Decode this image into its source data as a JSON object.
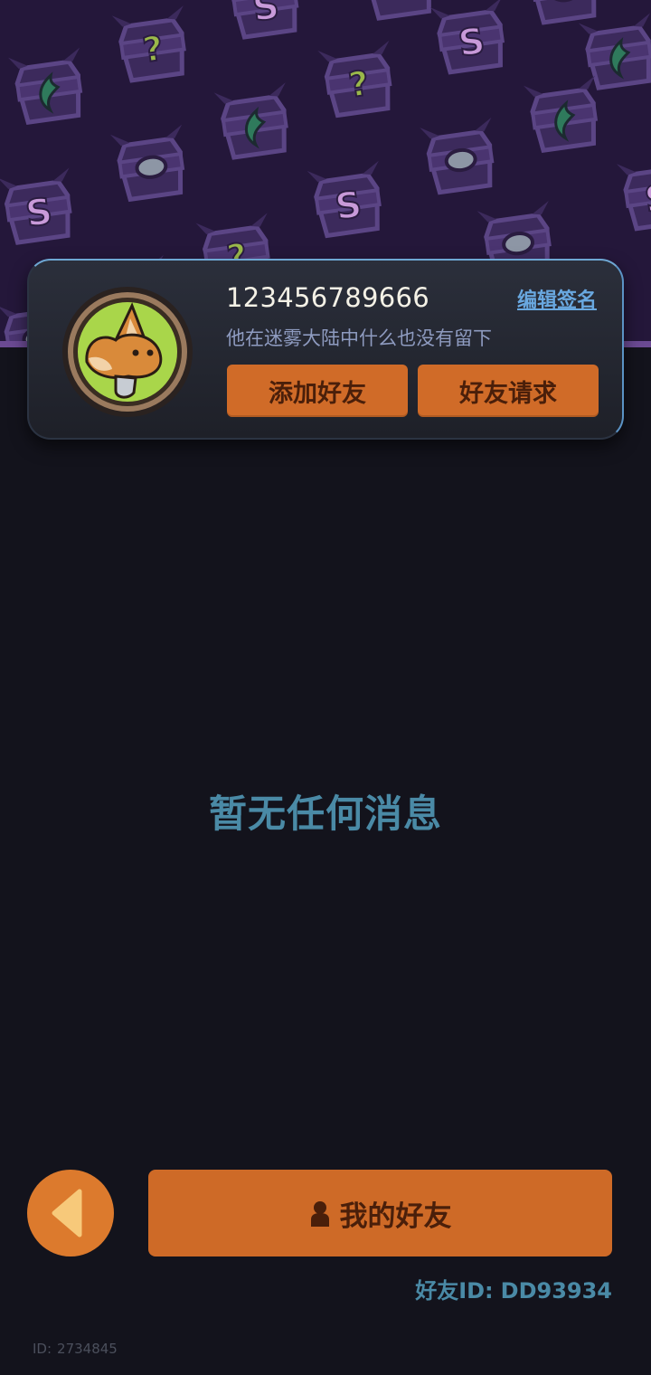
{
  "banner": {
    "pattern": "purple chest, question-mark, stone-eye and green-flame icon pattern",
    "colors": {
      "background": "#24173a",
      "accent_line": "#6b4a93"
    }
  },
  "profile": {
    "username": "123456789666",
    "edit_signature_label": "编辑签名",
    "signature": "他在迷雾大陆中什么也没有留下",
    "avatar": "fox-avatar",
    "add_friend_label": "添加好友",
    "friend_requests_label": "好友请求"
  },
  "main": {
    "empty_message": "暂无任何消息"
  },
  "footer": {
    "back_icon": "chevron-left-icon",
    "my_friends_label": "我的好友",
    "my_friends_icon": "person-icon",
    "friend_id_label": "好友ID:",
    "friend_id_value": "DD93934",
    "user_id_label": "ID:",
    "user_id_value": "2734845"
  },
  "colors": {
    "page_background": "#13131c",
    "button_orange": "#ce6a27",
    "button_text": "#4a1f0a",
    "accent_blue": "#4a8aa6",
    "link_blue": "#69a8e0"
  }
}
